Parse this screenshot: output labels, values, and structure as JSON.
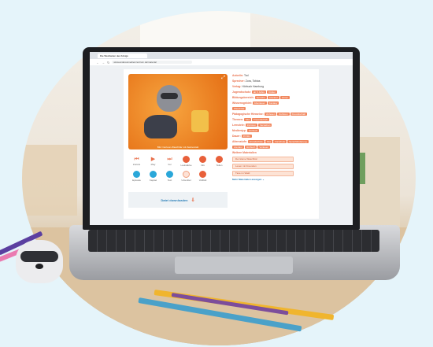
{
  "browser": {
    "tab_title": "Die Weisheiten des Königs",
    "url": "www.anderesmedienzentrum.de/material"
  },
  "hero": {
    "caption": "Bild: Cartoon-Waschbär mit Zauberstab",
    "badge": "Hörbuch"
  },
  "controls": [
    {
      "label": "Zurück"
    },
    {
      "label": "Play"
    },
    {
      "label": "Vor"
    },
    {
      "label": "Lautstärke"
    },
    {
      "label": "Info"
    },
    {
      "label": "Teilen"
    },
    {
      "label": "Episode"
    },
    {
      "label": "Kapitel"
    },
    {
      "label": "Text"
    },
    {
      "label": "Untertitel"
    },
    {
      "label": "Vollbild"
    }
  ],
  "download_label": "Datei downloaden",
  "meta": {
    "author_label": "Autor/in:",
    "author": "Tod",
    "speaker_label": "Sprecher:",
    "speaker": "Zora, Tobias",
    "publisher_label": "Verlag:",
    "publisher": "Hörbuch Hamburg",
    "row4_label": "Jugendschutz:",
    "row4_tags": [
      "ab 6 Jahre",
      "Kinder"
    ],
    "row5_label": "Bildungsbereich:",
    "row5_tags": [
      "Sprache",
      "Literatur",
      "Hören"
    ],
    "row6_label": "Wissensgebiet:",
    "row6_tags": [
      "Abenteuer",
      "Fantasy"
    ],
    "row7_tags": [
      "Waschbär"
    ],
    "row8_label": "Pädagogische Hinweise:",
    "row8_tags": [
      "Vorlesen",
      "Zuhören",
      "Freundschaft"
    ],
    "row9_label": "Themen:",
    "row9_tags": [
      "Mut",
      "Freundschaft"
    ],
    "row10_label": "Lernziele:",
    "row10_tags": [
      "Zuhören",
      "Verstehen"
    ],
    "row11_label": "Medientyp:",
    "row11_tags": [
      "Hörbuch"
    ],
    "row12_label": "Dauer:",
    "row12_tags": [
      "45 Min"
    ],
    "row13_label": "Altersstufe:",
    "row13_tags": [
      "Grundschule",
      "Kita",
      "Vorschule",
      "Sprachförderung"
    ],
    "row14_tags": [
      "Literatur",
      "Hörbuch",
      "Vorlesen"
    ],
    "related_heading": "Weitere Materialien",
    "refs": [
      "Der kleine Waschbär",
      "Lesen mit Freunden",
      "Tiere im Wald"
    ],
    "more_label": "Mehr Materialien anzeigen"
  }
}
